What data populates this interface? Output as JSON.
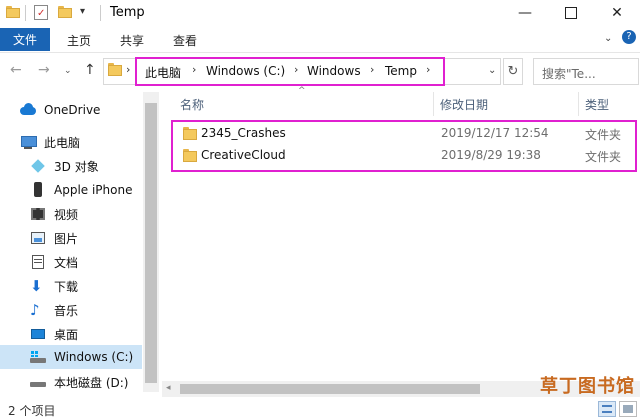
{
  "window": {
    "title": "Temp"
  },
  "ribbon": {
    "tabs": [
      "文件",
      "主页",
      "共享",
      "查看"
    ]
  },
  "address": {
    "crumbs": [
      "此电脑",
      "Windows (C:)",
      "Windows",
      "Temp"
    ],
    "search_placeholder": "搜索\"Te..."
  },
  "sidebar": {
    "items": [
      {
        "label": "OneDrive",
        "icon": "onedrive-cloud-icon"
      },
      {
        "label": "此电脑",
        "icon": "computer-icon"
      },
      {
        "label": "3D 对象",
        "icon": "3d-objects-icon"
      },
      {
        "label": "Apple iPhone",
        "icon": "phone-icon"
      },
      {
        "label": "视频",
        "icon": "video-icon"
      },
      {
        "label": "图片",
        "icon": "pictures-icon"
      },
      {
        "label": "文档",
        "icon": "documents-icon"
      },
      {
        "label": "下载",
        "icon": "download-arrow-icon"
      },
      {
        "label": "音乐",
        "icon": "music-note-icon"
      },
      {
        "label": "桌面",
        "icon": "desktop-icon"
      },
      {
        "label": "Windows (C:)",
        "icon": "drive-c-icon",
        "selected": true
      },
      {
        "label": "本地磁盘 (D:)",
        "icon": "drive-d-icon"
      }
    ]
  },
  "columns": {
    "name": "名称",
    "date": "修改日期",
    "type": "类型"
  },
  "files": [
    {
      "name": "2345_Crashes",
      "date": "2019/12/17 12:54",
      "type": "文件夹"
    },
    {
      "name": "CreativeCloud",
      "date": "2019/8/29 19:38",
      "type": "文件夹"
    }
  ],
  "status": {
    "count_text": "2 个项目"
  },
  "watermark": {
    "text": "草丁图书馆"
  },
  "colors": {
    "accent": "#1a64b4",
    "highlight_box": "#e020d0",
    "selection": "#cce4f7",
    "folder": "#f4c95d"
  }
}
